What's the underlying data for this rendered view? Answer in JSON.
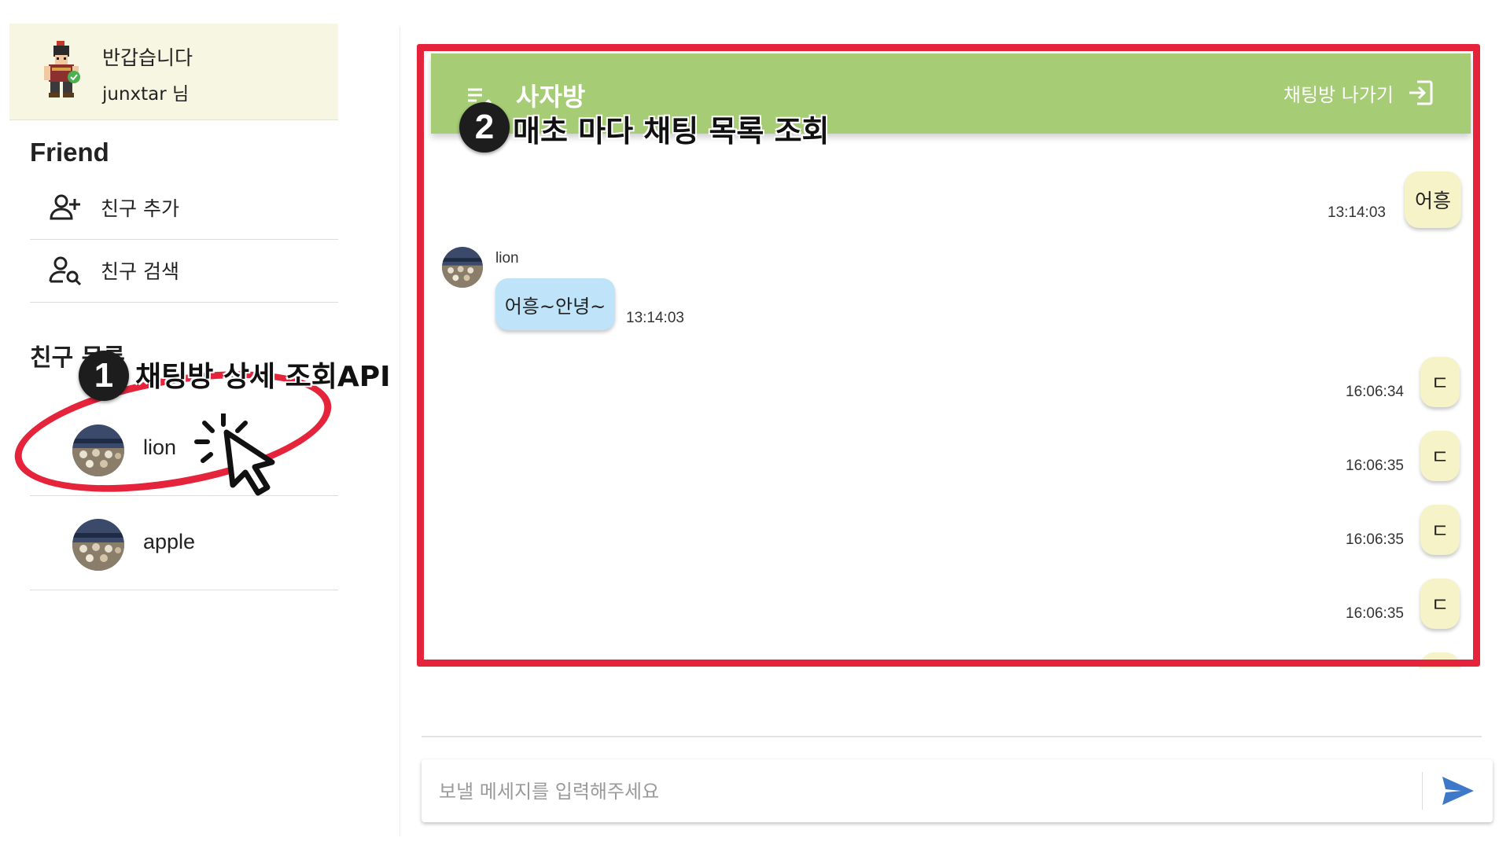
{
  "user": {
    "greeting": "반갑습니다",
    "name": "junxtar 님"
  },
  "sidebar": {
    "section_title": "Friend",
    "menu": [
      {
        "label": "친구 추가",
        "icon": "person-add-icon"
      },
      {
        "label": "친구 검색",
        "icon": "person-search-icon"
      }
    ],
    "list_title": "친구 목록",
    "friends": [
      {
        "name": "lion"
      },
      {
        "name": "apple"
      }
    ]
  },
  "chat": {
    "room_name": "사자방",
    "leave_label": "채팅방 나가기",
    "header_icon": "edit-list-icon",
    "leave_icon": "logout-icon",
    "messages": [
      {
        "mine": true,
        "text": "어흥",
        "time": "13:14:03"
      },
      {
        "mine": false,
        "sender": "lion",
        "text": "어흥~안녕~",
        "time": "13:14:03"
      },
      {
        "mine": true,
        "text": "ㄷ",
        "time": "16:06:34"
      },
      {
        "mine": true,
        "text": "ㄷ",
        "time": "16:06:35"
      },
      {
        "mine": true,
        "text": "ㄷ",
        "time": "16:06:35"
      },
      {
        "mine": true,
        "text": "ㄷ",
        "time": "16:06:35"
      }
    ]
  },
  "input": {
    "placeholder": "보낼 메세지를 입력해주세요",
    "send_icon": "send-icon"
  },
  "annotations": [
    {
      "number": "1",
      "text": "채팅방 상세 조회API"
    },
    {
      "number": "2",
      "text": "매초 마다 채팅 목록 조회"
    }
  ],
  "colors": {
    "header": "#a6cc75",
    "my_bubble": "#f5f3c7",
    "other_bubble": "#bfe3f8",
    "user_card": "#f6f6e3",
    "annotation_red": "#e5233b",
    "send": "#3f78c8"
  }
}
